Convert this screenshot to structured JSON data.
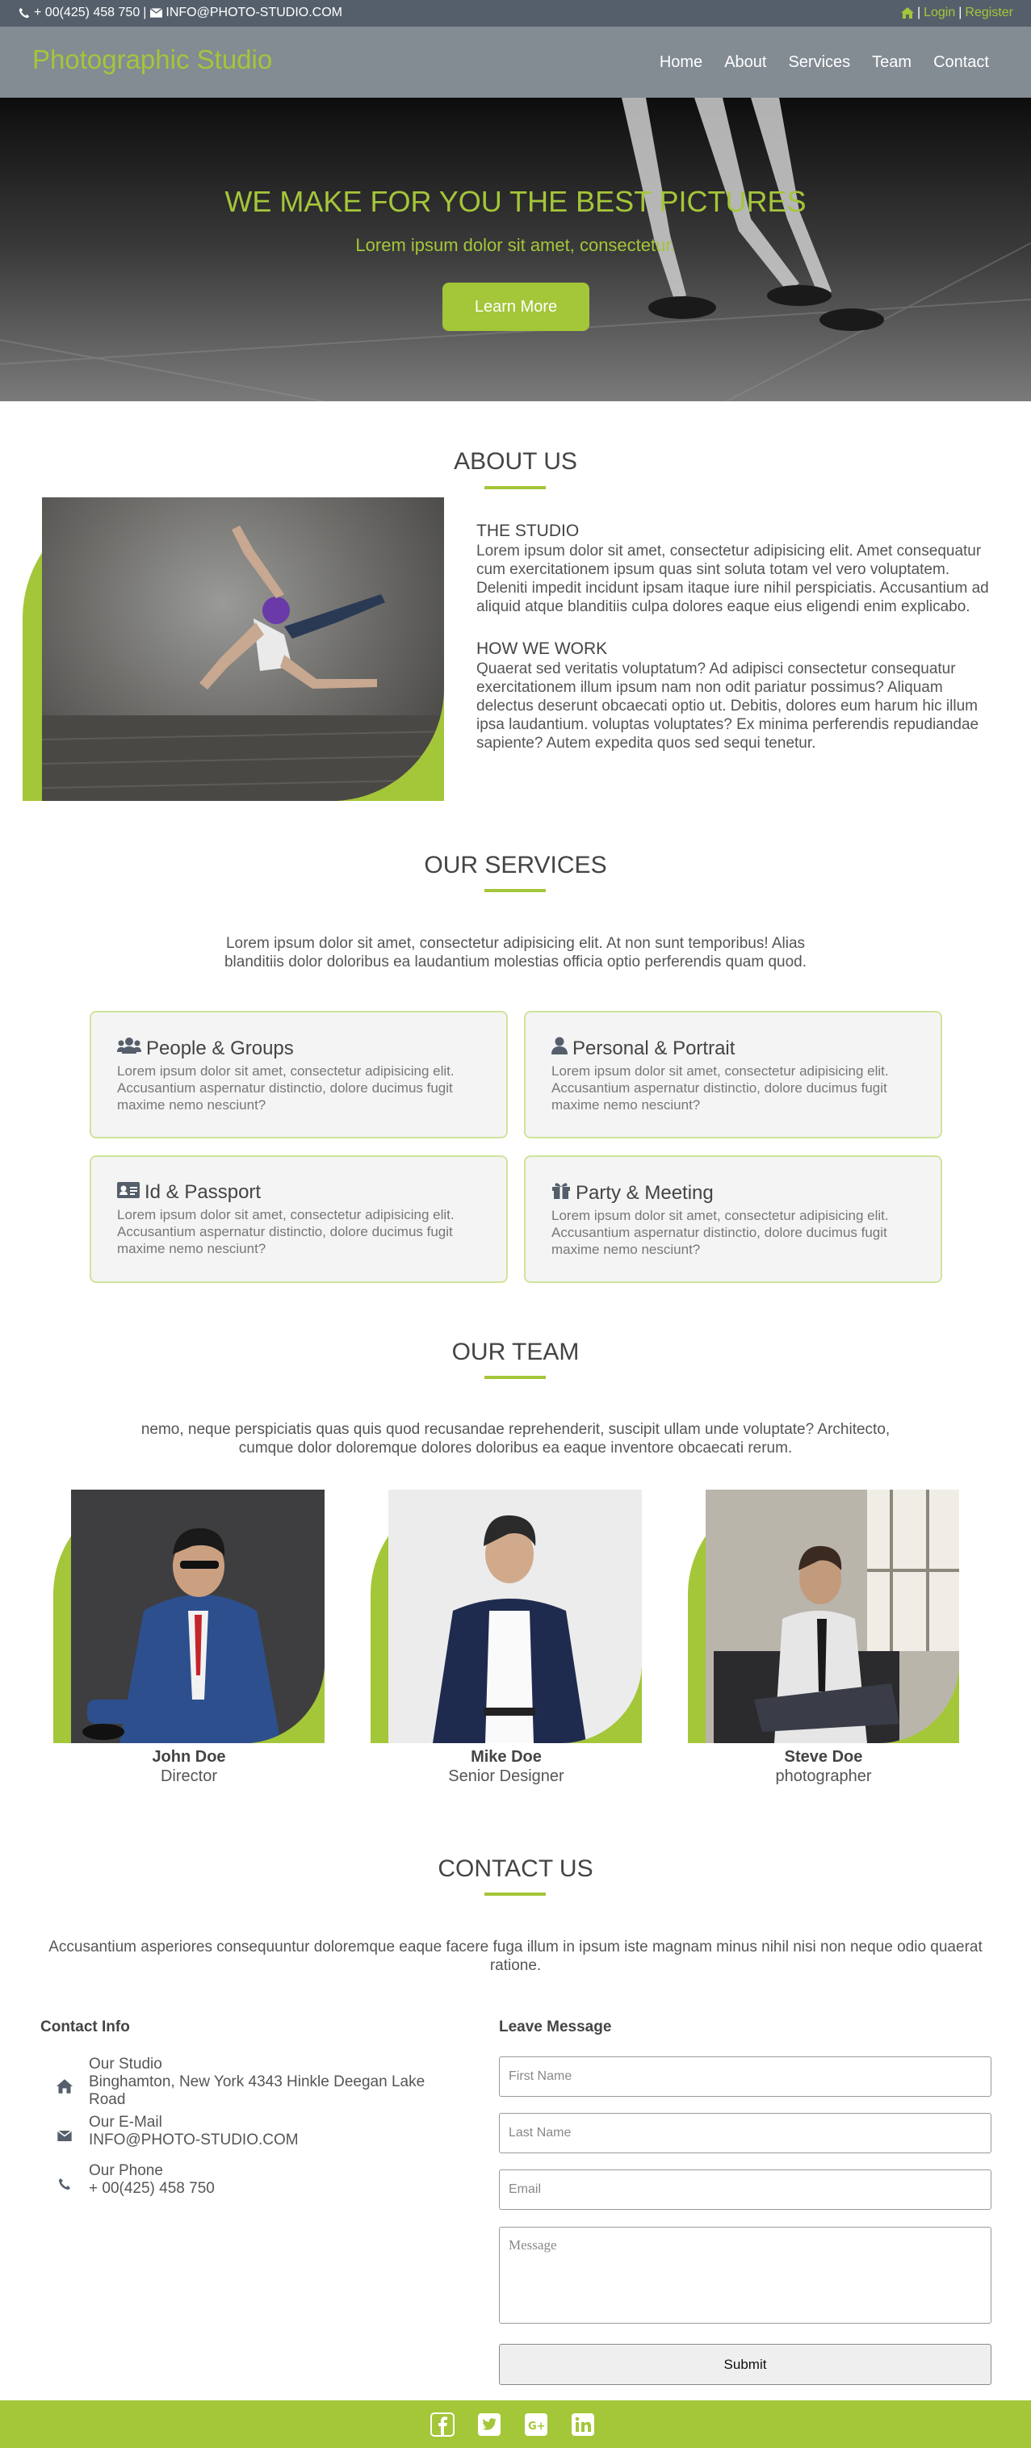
{
  "topbar": {
    "phone": "+ 00(425) 458 750",
    "email": "INFO@PHOTO-STUDIO.COM",
    "login": "Login",
    "register": "Register",
    "separator": "|",
    "icons": {
      "phone": "phone-icon",
      "email": "envelope-icon",
      "home": "home-icon"
    }
  },
  "header": {
    "brand": "Photographic Studio",
    "nav": [
      "Home",
      "About",
      "Services",
      "Team",
      "Contact"
    ]
  },
  "hero": {
    "title": "WE MAKE FOR YOU THE BEST PICTURES",
    "subtitle": "Lorem ipsum dolor sit amet, consectetur.",
    "cta": "Learn More"
  },
  "about": {
    "title": "ABOUT US",
    "blocks": [
      {
        "heading": "THE STUDIO",
        "text": "Lorem ipsum dolor sit amet, consectetur adipisicing elit. Amet consequatur cum exercitationem ipsum quas sint soluta totam vel vero voluptatem. Deleniti impedit incidunt ipsam itaque iure nihil perspiciatis. Accusantium ad aliquid atque blanditiis culpa dolores eaque eius eligendi enim explicabo."
      },
      {
        "heading": "HOW WE WORK",
        "text": "Quaerat sed veritatis voluptatum? Ad adipisci consectetur consequatur exercitationem illum ipsum nam non odit pariatur possimus? Aliquam delectus deserunt obcaecati optio ut. Debitis, dolores eum harum hic illum ipsa laudantium. voluptas voluptates? Ex minima perferendis repudiandae sapiente? Autem expedita quos sed sequi tenetur."
      }
    ]
  },
  "services": {
    "title": "OUR SERVICES",
    "intro": "Lorem ipsum dolor sit amet, consectetur adipisicing elit. At non sunt temporibus! Alias blanditiis dolor doloribus ea laudantium molestias officia optio perferendis quam quod.",
    "items": [
      {
        "title": "People & Groups",
        "icon": "users-icon",
        "text": "Lorem ipsum dolor sit amet, consectetur adipisicing elit. Accusantium aspernatur distinctio, dolore ducimus fugit maxime nemo nesciunt?"
      },
      {
        "title": "Personal & Portrait",
        "icon": "user-icon",
        "text": "Lorem ipsum dolor sit amet, consectetur adipisicing elit. Accusantium aspernatur distinctio, dolore ducimus fugit maxime nemo nesciunt?"
      },
      {
        "title": "Id & Passport",
        "icon": "id-card-icon",
        "text": "Lorem ipsum dolor sit amet, consectetur adipisicing elit. Accusantium aspernatur distinctio, dolore ducimus fugit maxime nemo nesciunt?"
      },
      {
        "title": "Party & Meeting",
        "icon": "gift-icon",
        "text": "Lorem ipsum dolor sit amet, consectetur adipisicing elit. Accusantium aspernatur distinctio, dolore ducimus fugit maxime nemo nesciunt?"
      }
    ]
  },
  "team": {
    "title": "OUR TEAM",
    "intro": "nemo, neque perspiciatis quas quis quod recusandae reprehenderit, suscipit ullam unde voluptate? Architecto, cumque dolor doloremque dolores doloribus ea eaque inventore obcaecati rerum.",
    "members": [
      {
        "name": "John Doe",
        "role": "Director"
      },
      {
        "name": "Mike Doe",
        "role": "Senior Designer"
      },
      {
        "name": "Steve Doe",
        "role": "photographer"
      }
    ]
  },
  "contact": {
    "title": "CONTACT US",
    "intro": "Accusantium asperiores consequuntur doloremque eaque facere fuga illum in ipsum iste magnam minus nihil nisi non neque odio quaerat ratione.",
    "info_heading": "Contact Info",
    "info": [
      {
        "label": "Our Studio",
        "value": "Binghamton, New York 4343 Hinkle Deegan Lake Road",
        "icon": "home-icon"
      },
      {
        "label": "Our E-Mail",
        "value": "INFO@PHOTO-STUDIO.COM",
        "icon": "envelope-icon"
      },
      {
        "label": "Our Phone",
        "value": "+ 00(425) 458 750",
        "icon": "phone-icon"
      }
    ],
    "form_heading": "Leave Message",
    "form": {
      "first_name_placeholder": "First Name",
      "last_name_placeholder": "Last Name",
      "email_placeholder": "Email",
      "message_placeholder": "Message",
      "submit": "Submit"
    }
  },
  "footer": {
    "social": [
      "facebook-icon",
      "twitter-icon",
      "google-plus-icon",
      "linkedin-icon"
    ]
  },
  "colors": {
    "accent": "#a4c639",
    "topbar": "#555f6b",
    "header": "#838b93",
    "text": "#444444"
  }
}
